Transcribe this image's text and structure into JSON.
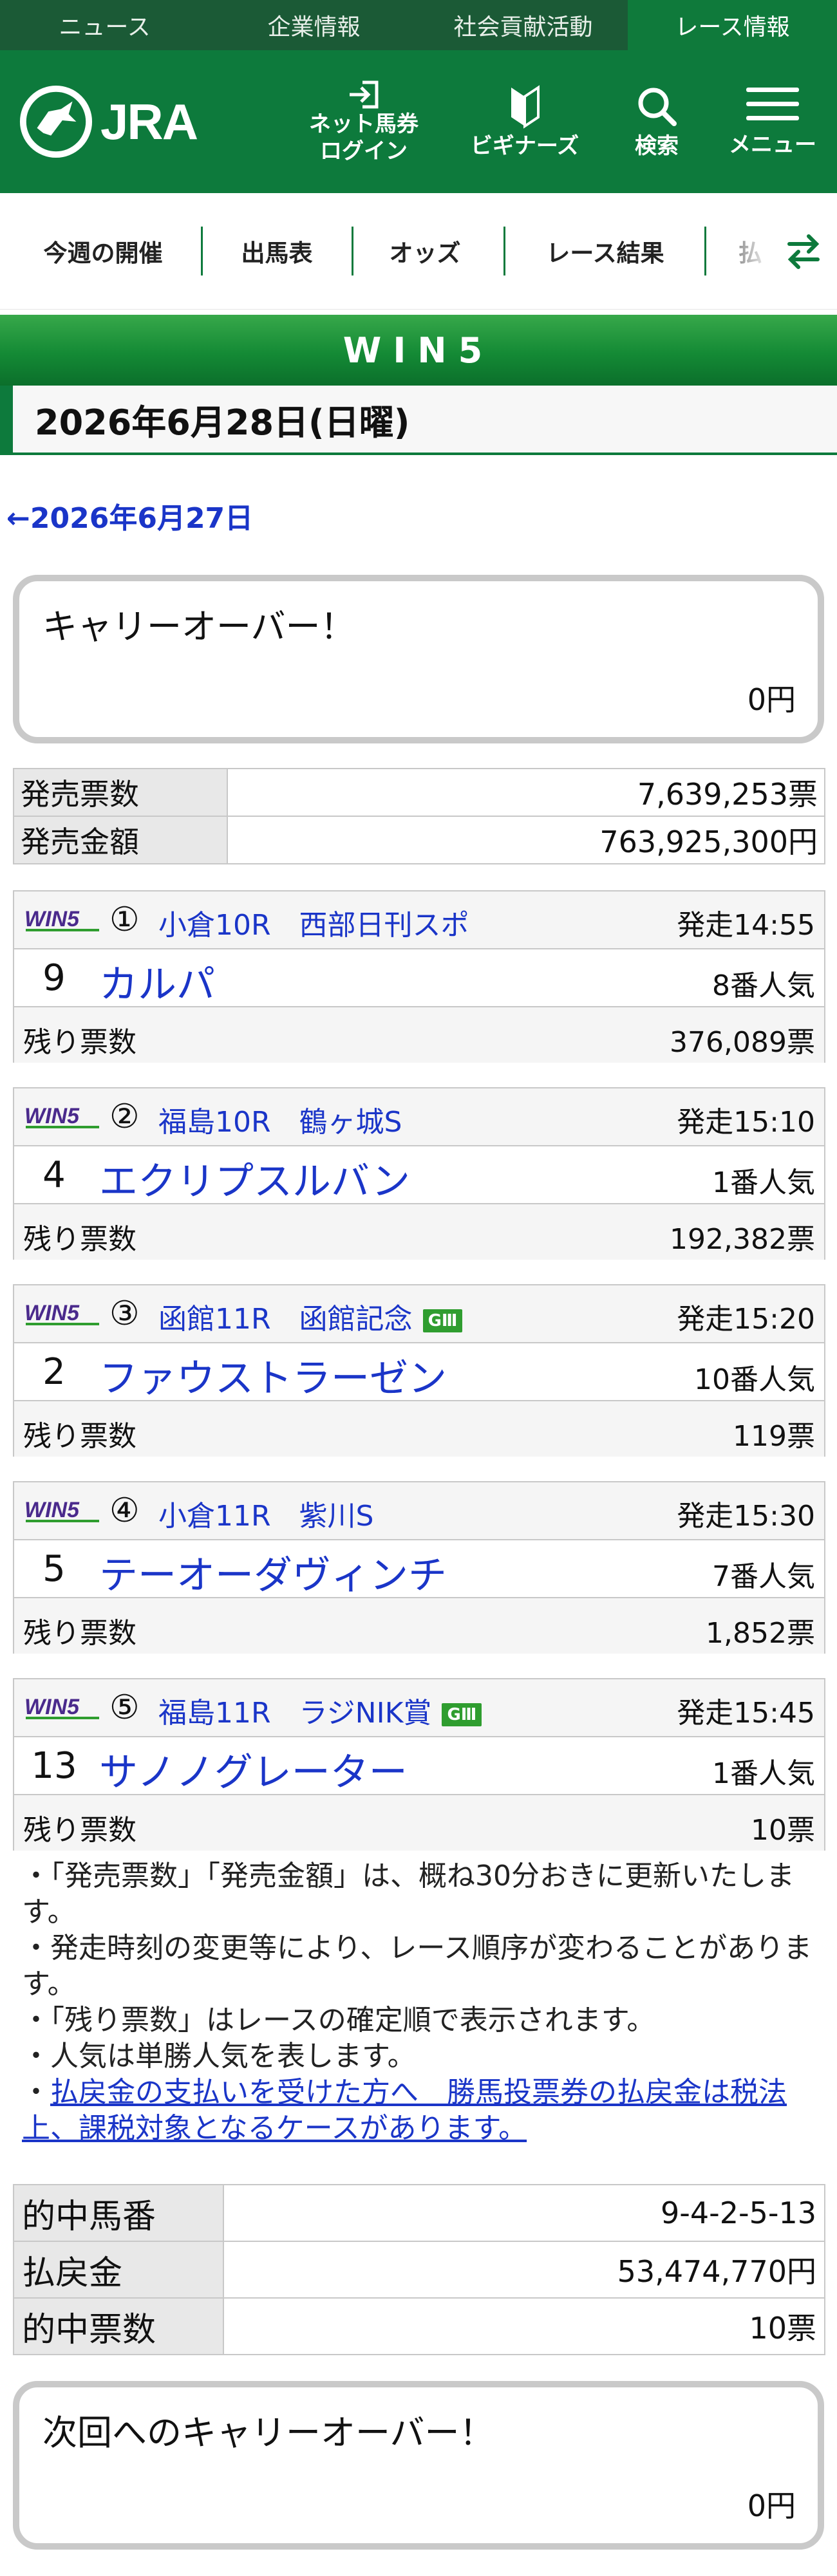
{
  "topnav": [
    "ニュース",
    "企業情報",
    "社会貢献活動",
    "レース情報"
  ],
  "header": {
    "logo_text": "JRA",
    "login_label_1": "ネット馬券",
    "login_label_2": "ログイン",
    "beginner_label": "ビギナーズ",
    "search_label": "検索",
    "menu_label": "メニュー"
  },
  "tabs": [
    "今週の開催",
    "出馬表",
    "オッズ",
    "レース結果",
    "払"
  ],
  "banner": "WIN5",
  "date_heading": "2026年6月28日(日曜)",
  "prev_link": "←2026年6月27日",
  "carryover": {
    "title": "キャリーオーバー！",
    "amount": "0円"
  },
  "sales": [
    {
      "label": "発売票数",
      "value": "7,639,253票"
    },
    {
      "label": "発売金額",
      "value": "763,925,300円"
    }
  ],
  "win5_logo_text": "WIN5",
  "races": [
    {
      "leg": "①",
      "name": "小倉10R　西部日刊スポ",
      "grade": "",
      "start": "発走14:55",
      "horse_no": "9",
      "horse": "カルパ",
      "popularity": "8番人気",
      "remaining_label": "残り票数",
      "remaining": "376,089票"
    },
    {
      "leg": "②",
      "name": "福島10R　鶴ヶ城S",
      "grade": "",
      "start": "発走15:10",
      "horse_no": "4",
      "horse": "エクリプスルバン",
      "popularity": "1番人気",
      "remaining_label": "残り票数",
      "remaining": "192,382票"
    },
    {
      "leg": "③",
      "name": "函館11R　函館記念",
      "grade": "GⅢ",
      "start": "発走15:20",
      "horse_no": "2",
      "horse": "ファウストラーゼン",
      "popularity": "10番人気",
      "remaining_label": "残り票数",
      "remaining": "119票"
    },
    {
      "leg": "④",
      "name": "小倉11R　紫川S",
      "grade": "",
      "start": "発走15:30",
      "horse_no": "5",
      "horse": "テーオーダヴィンチ",
      "popularity": "7番人気",
      "remaining_label": "残り票数",
      "remaining": "1,852票"
    },
    {
      "leg": "⑤",
      "name": "福島11R　ラジNIK賞",
      "grade": "GⅢ",
      "start": "発走15:45",
      "horse_no": "13",
      "horse": "サノノグレーター",
      "popularity": "1番人気",
      "remaining_label": "残り票数",
      "remaining": "10票"
    }
  ],
  "notes": {
    "n1": "・「発売票数」「発売金額」は、概ね30分おきに更新いたします。",
    "n2": "・発走時刻の変更等により、レース順序が変わることがあります。",
    "n3": "・「残り票数」はレースの確定順で表示されます。",
    "n4": "・人気は単勝人気を表します。",
    "n5_prefix": "・",
    "n5_link": "払戻金の支払いを受けた方へ　勝馬投票券の払戻金は税法上、課税対象となるケースがあります。"
  },
  "result": [
    {
      "label": "的中馬番",
      "value": "9-4-2-5-13"
    },
    {
      "label": "払戻金",
      "value": "53,474,770円"
    },
    {
      "label": "的中票数",
      "value": "10票"
    }
  ],
  "next_carryover": {
    "title": "次回へのキャリーオーバー！",
    "amount": "0円"
  },
  "colors": {
    "brand_green": "#0d7a3c",
    "dark_green": "#1b5a36",
    "link_blue": "#1a35c8",
    "grade_green": "#2f9d2f"
  }
}
